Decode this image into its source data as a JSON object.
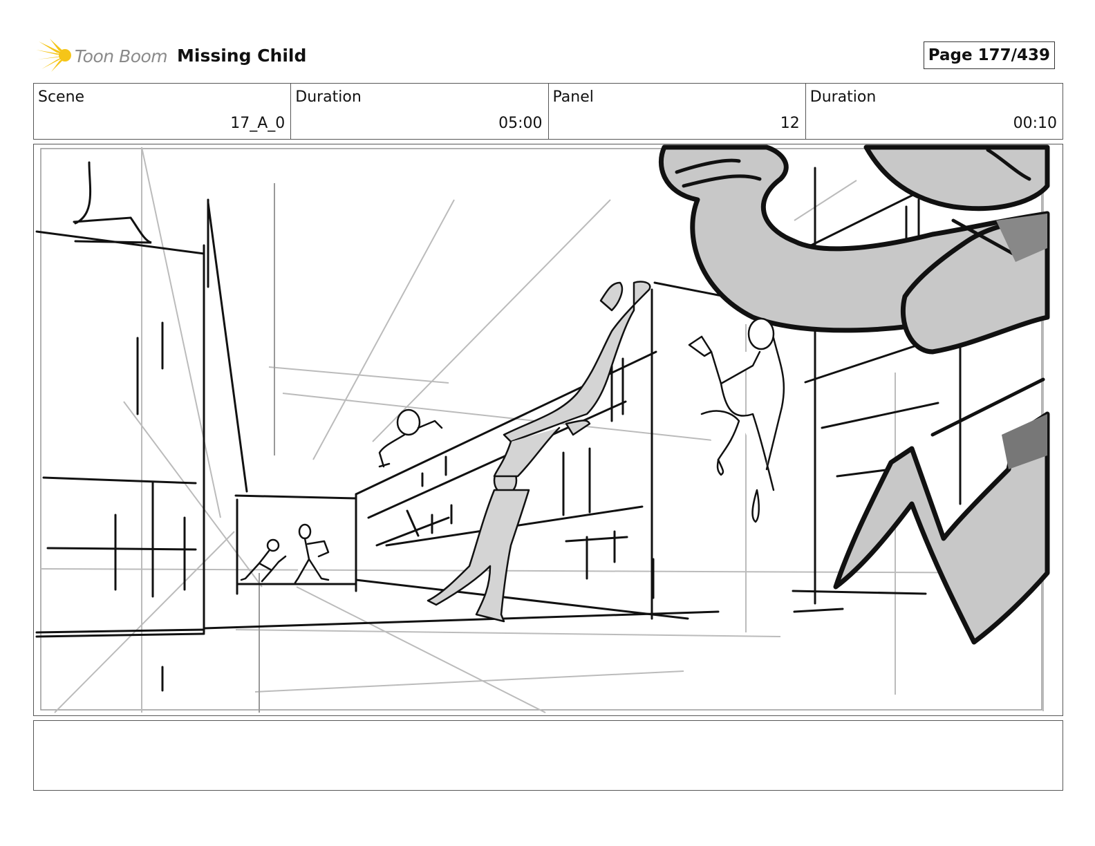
{
  "header": {
    "brand": "Toon Boom",
    "project_title": "Missing Child",
    "page_label": "Page 177/439"
  },
  "info": {
    "scene_label": "Scene",
    "scene_value": "17_A_0",
    "scene_duration_label": "Duration",
    "scene_duration_value": "05:00",
    "panel_label": "Panel",
    "panel_value": "12",
    "panel_duration_label": "Duration",
    "panel_duration_value": "00:10"
  },
  "notes": {
    "text": ""
  },
  "colors": {
    "logo_burst": "#f5c518",
    "logo_text": "#8a8a8a",
    "sketch_line": "#111111",
    "guide_line": "#bbbbbb",
    "fill_gray": "#c8c8c8"
  }
}
